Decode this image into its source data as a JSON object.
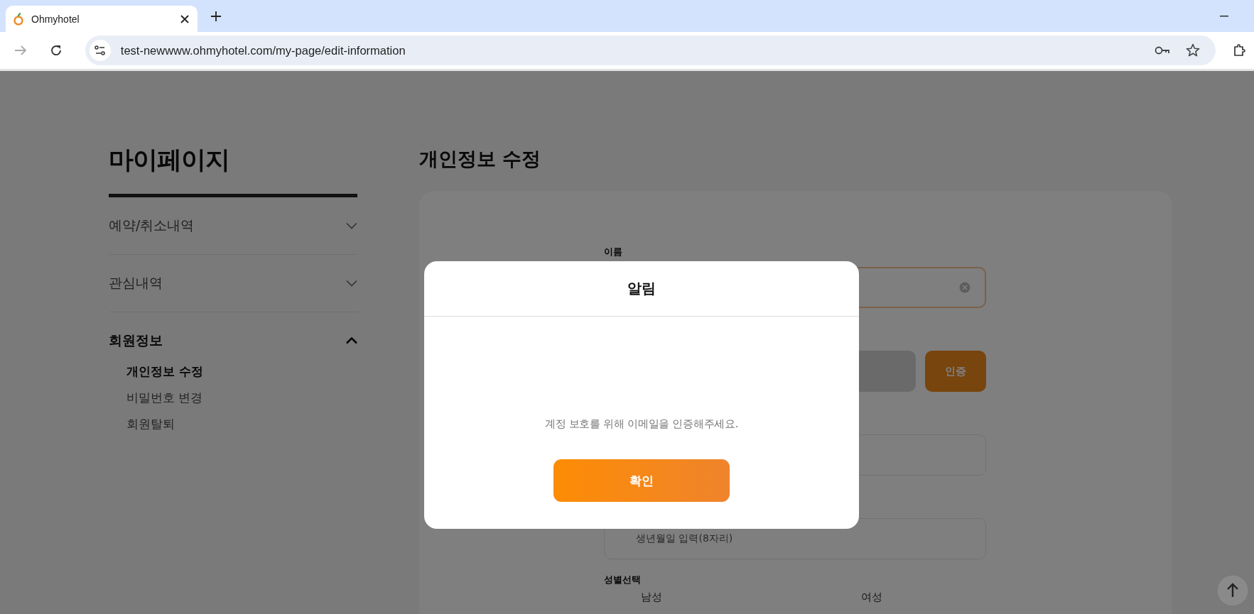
{
  "browser": {
    "tab": {
      "title": "Ohmyhotel"
    },
    "url": "test-newwww.ohmyhotel.com/my-page/edit-information",
    "back_disabled": true
  },
  "sidebar": {
    "title": "마이페이지",
    "sections": [
      {
        "label": "예약/취소내역",
        "expanded": false
      },
      {
        "label": "관심내역",
        "expanded": false
      },
      {
        "label": "회원정보",
        "expanded": true,
        "children": [
          {
            "label": "개인정보 수정",
            "selected": true
          },
          {
            "label": "비밀번호 변경",
            "selected": false
          },
          {
            "label": "회원탈퇴",
            "selected": false
          }
        ]
      }
    ]
  },
  "main": {
    "heading": "개인정보 수정",
    "form": {
      "fields": [
        {
          "kind": "text",
          "label": "이름",
          "focused": true,
          "clearable": true
        },
        {
          "kind": "verify",
          "button": "인증"
        },
        {
          "kind": "text",
          "focused": false
        },
        {
          "kind": "text",
          "focused": false,
          "placeholder": "생년월일 입력(8자리)"
        }
      ],
      "gender": {
        "label": "성별선택",
        "options": [
          {
            "label": "남성"
          },
          {
            "label": "여성"
          }
        ]
      }
    }
  },
  "modal": {
    "title": "알림",
    "message": "계정 보호를 위해 이메일을 인증해주세요.",
    "button": "확인"
  }
}
